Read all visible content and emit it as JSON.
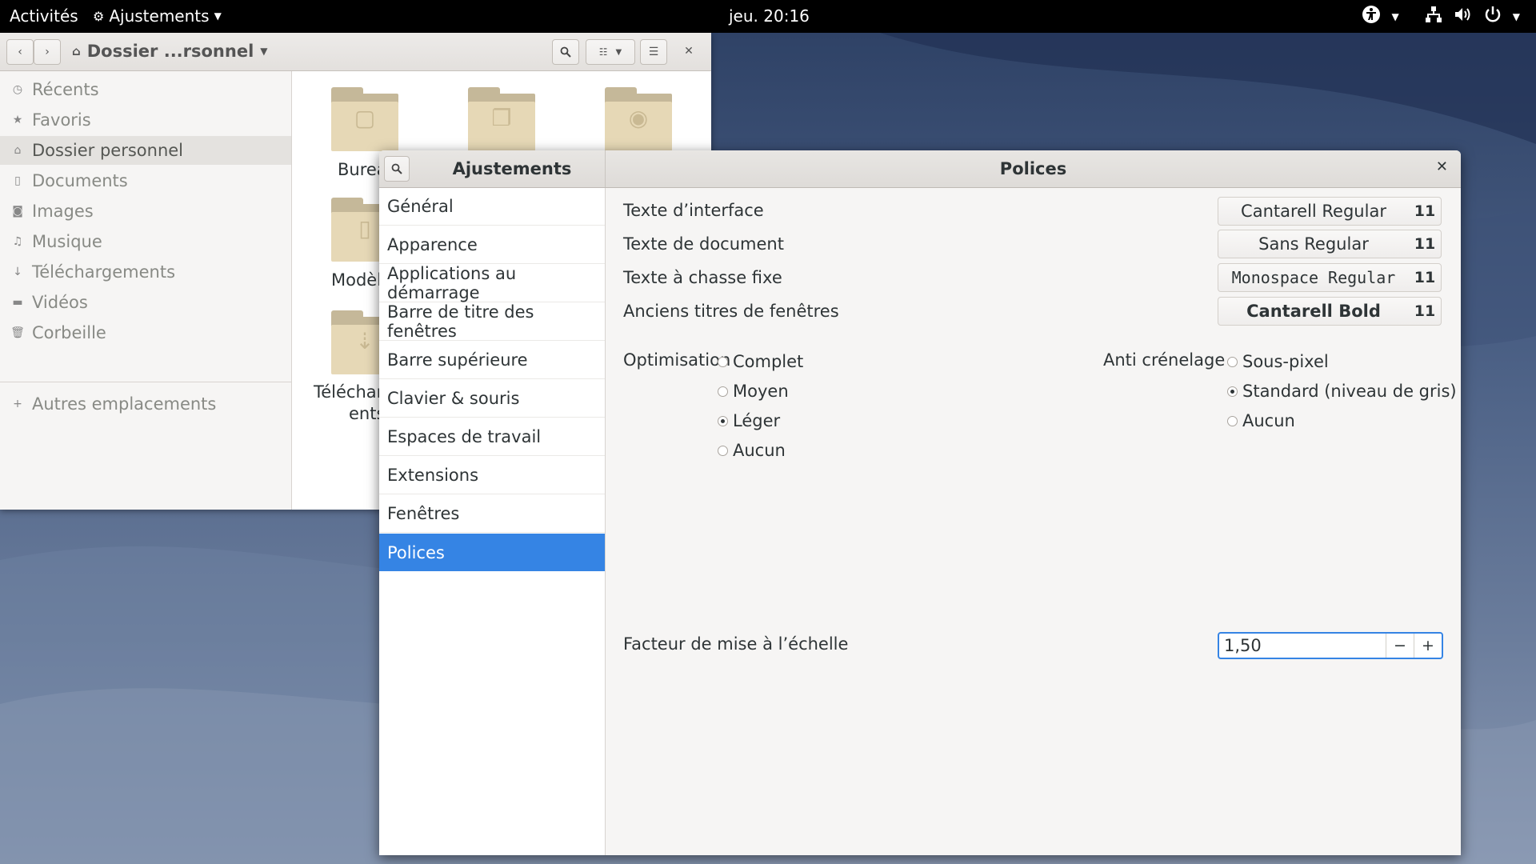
{
  "topbar": {
    "activities": "Activités",
    "app_name": "Ajustements",
    "clock": "jeu. 20:16",
    "icons": [
      "accessibility-icon",
      "network-icon",
      "volume-icon",
      "power-icon"
    ]
  },
  "files": {
    "path": "Dossier ...rsonnel",
    "sidebar": [
      {
        "label": "Récents",
        "icon": "clock-icon"
      },
      {
        "label": "Favoris",
        "icon": "star-icon"
      },
      {
        "label": "Dossier personnel",
        "icon": "home-icon",
        "active": true
      },
      {
        "label": "Documents",
        "icon": "document-icon"
      },
      {
        "label": "Images",
        "icon": "camera-icon"
      },
      {
        "label": "Musique",
        "icon": "music-icon"
      },
      {
        "label": "Téléchargements",
        "icon": "download-icon"
      },
      {
        "label": "Vidéos",
        "icon": "video-icon"
      },
      {
        "label": "Corbeille",
        "icon": "trash-icon"
      }
    ],
    "other_locations": "Autres emplacements",
    "folders": [
      {
        "label": "Burea"
      },
      {
        "label": ""
      },
      {
        "label": ""
      },
      {
        "label": "Modèl"
      },
      {
        "label": "Téléchar"
      },
      {
        "label": "ents"
      }
    ]
  },
  "tweaks": {
    "app_title": "Ajustements",
    "page_title": "Polices",
    "sidebar": [
      "Général",
      "Apparence",
      "Applications au démarrage",
      "Barre de titre des fenêtres",
      "Barre supérieure",
      "Clavier & souris",
      "Espaces de travail",
      "Extensions",
      "Fenêtres",
      "Polices"
    ],
    "selected": "Polices",
    "fonts": [
      {
        "label": "Texte d’interface",
        "font": "Cantarell Regular",
        "size": "11"
      },
      {
        "label": "Texte de document",
        "font": "Sans Regular",
        "size": "11"
      },
      {
        "label": "Texte à chasse fixe",
        "font": "Monospace Regular",
        "size": "11"
      },
      {
        "label": "Anciens titres de fenêtres",
        "font": "Cantarell Bold",
        "size": "11"
      }
    ],
    "hinting": {
      "label": "Optimisation",
      "options": [
        "Complet",
        "Moyen",
        "Léger",
        "Aucun"
      ],
      "selected": "Léger"
    },
    "antialiasing": {
      "label": "Anti crénelage",
      "options": [
        "Sous-pixel",
        "Standard (niveau de gris)",
        "Aucun"
      ],
      "selected": "Standard (niveau de gris)"
    },
    "scaling": {
      "label": "Facteur de mise à l’échelle",
      "value": "1,50",
      "minus": "−",
      "plus": "+"
    },
    "accent_color": "#3584e4"
  }
}
